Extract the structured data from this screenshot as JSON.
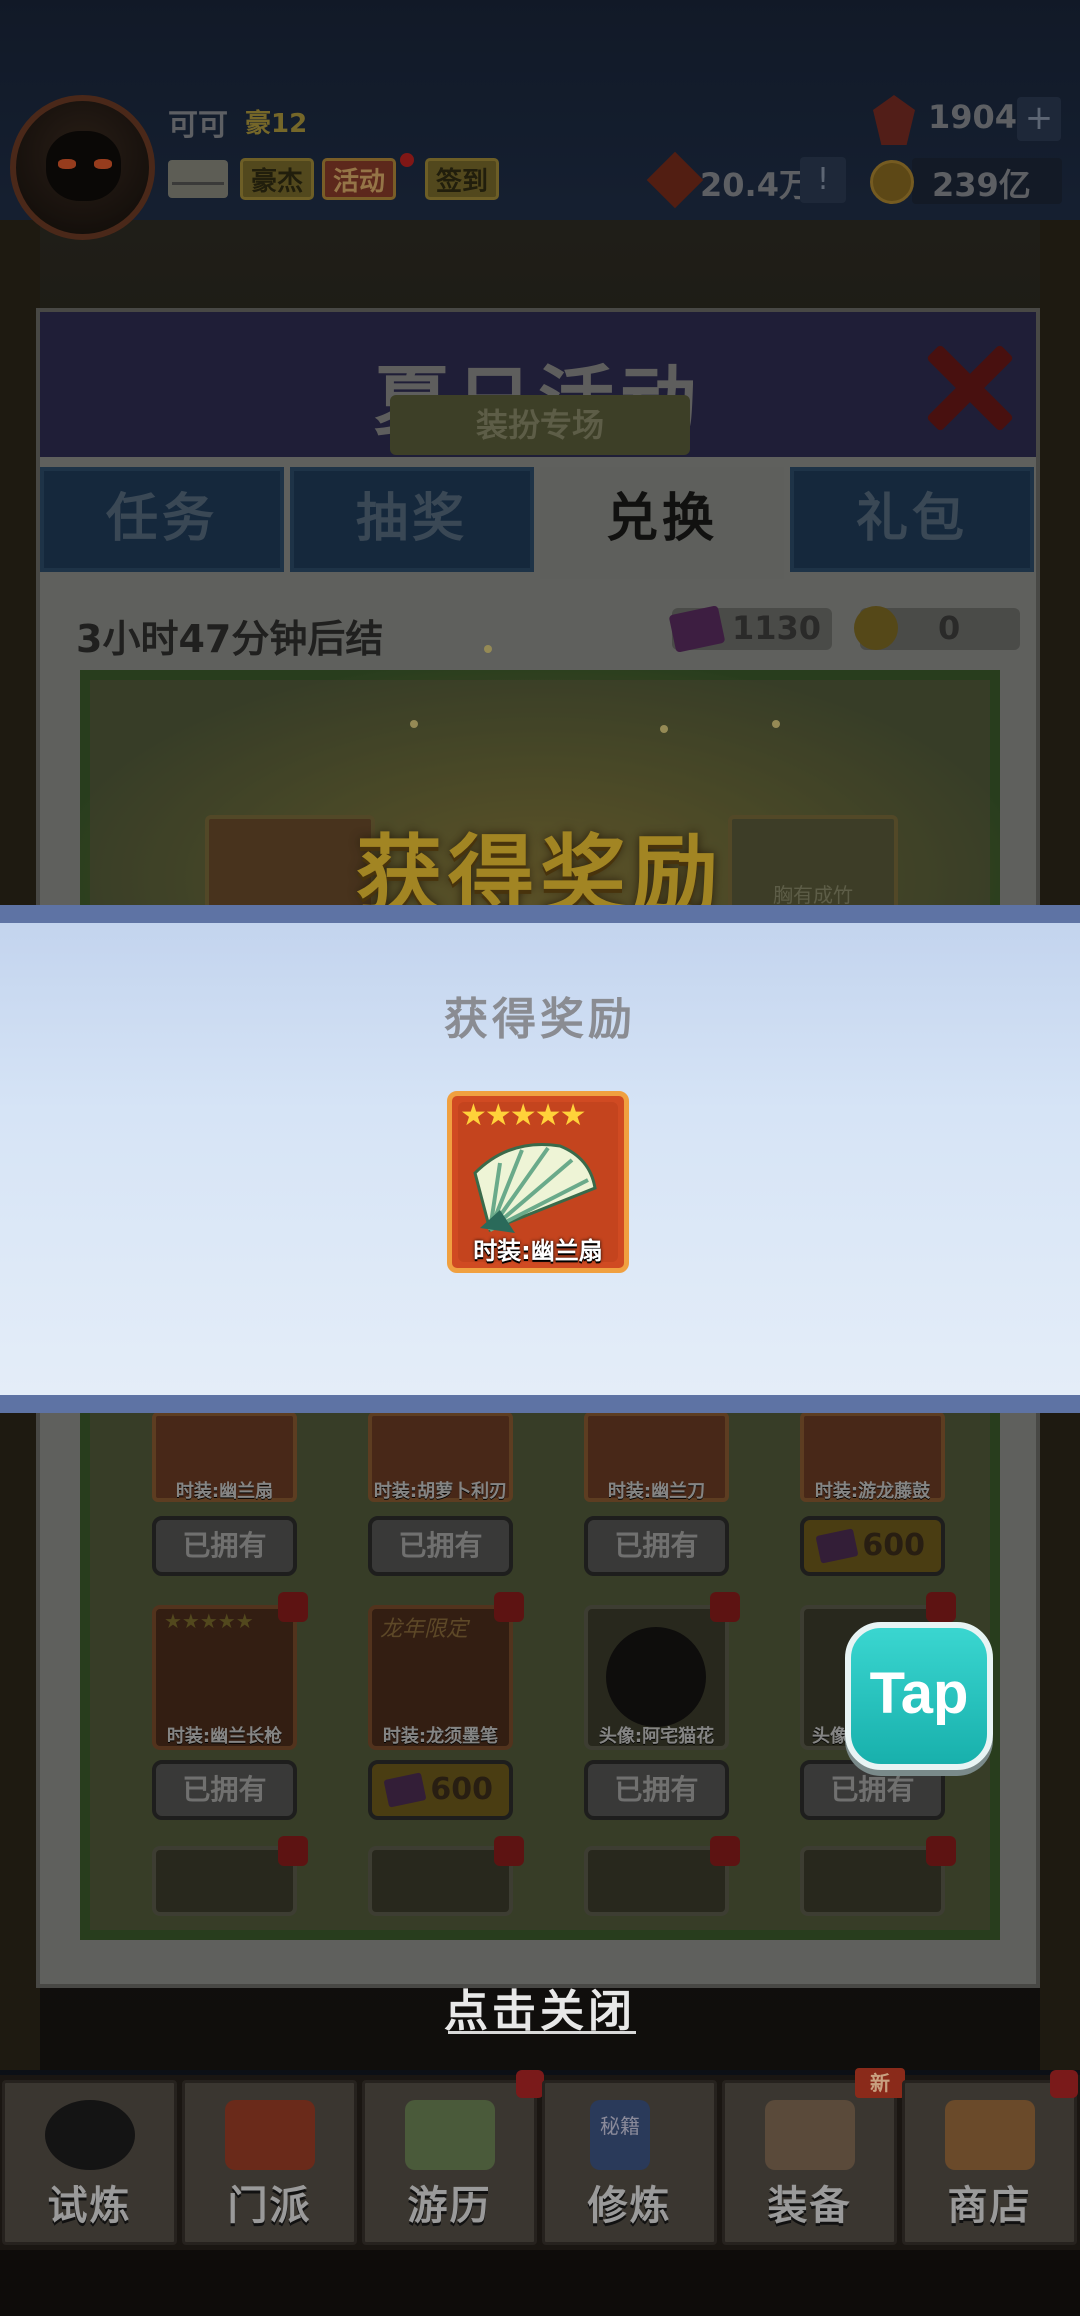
{
  "player": {
    "name": "可可",
    "title": "豪12"
  },
  "top_buttons": {
    "hero": "豪杰",
    "event": "活动",
    "sign": "签到"
  },
  "resources": {
    "gems": "1904",
    "power": "20.4万",
    "coins": "239亿"
  },
  "panel": {
    "title": "夏日活动",
    "tabs": [
      "任务",
      "抽奖",
      "兑换",
      "礼包"
    ],
    "active_tab": "兑换",
    "timer": "3小时47分钟后结",
    "ticket_count": "1130",
    "leaf_count": "0",
    "section_banner": "装扮专场",
    "big_reward_text": "获得奖励",
    "card_caption": "胸有成竹"
  },
  "popup": {
    "title": "获得奖励",
    "reward": {
      "stars": "★★★★★",
      "label": "时装:幽兰扇"
    }
  },
  "grid": {
    "row1": [
      {
        "label": "时装:幽兰扇",
        "button": "已拥有"
      },
      {
        "label": "时装:胡萝卜利刃",
        "button": "已拥有"
      },
      {
        "label": "时装:幽兰刀",
        "button": "已拥有"
      },
      {
        "label": "时装:游龙藤鼓",
        "button": "600"
      }
    ],
    "row2": [
      {
        "label": "时装:幽兰长枪",
        "button": "已拥有",
        "stars": "★★★★★"
      },
      {
        "label": "时装:龙须墨笔",
        "button": "600",
        "tag": "龙年限定"
      },
      {
        "label": "头像:阿宅猫花",
        "button": "已拥有"
      },
      {
        "label": "头像",
        "button": "已拥有"
      }
    ]
  },
  "tap_button": "Tap",
  "close_hint": "点击关闭",
  "nav": {
    "items": [
      "试炼",
      "门派",
      "游历",
      "修炼",
      "装备",
      "商店"
    ],
    "new_badge": "新",
    "secret_book": "秘籍"
  },
  "colors": {
    "popup_border": "#5e73a4",
    "reward_gold": "#f4c834",
    "tap_teal": "#18b0ac",
    "card_red": "#d04a22"
  }
}
